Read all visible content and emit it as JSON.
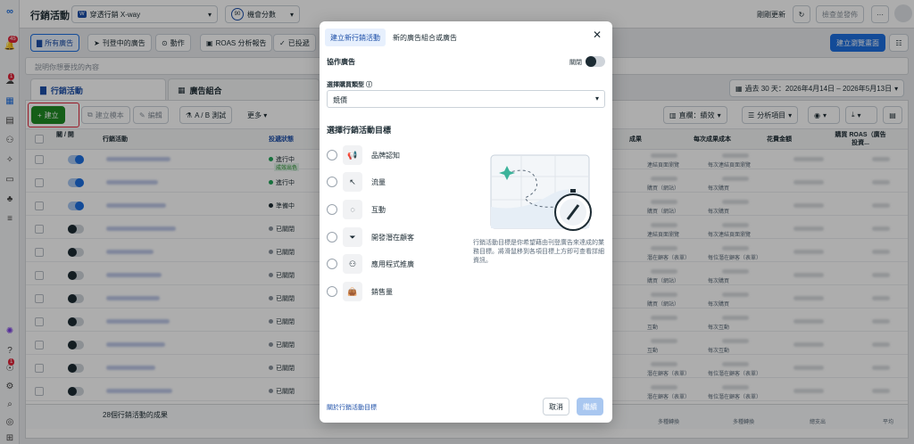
{
  "topbar": {
    "title": "行銷活動",
    "account": "穿透行銷 X-way",
    "score": "90",
    "score_label": "機會分數",
    "update": "剛剛更新",
    "review": "檢查並發佈",
    "more": "···"
  },
  "tabs": [
    "所有廣告",
    "刊登中的廣告",
    "動作",
    "ROAS 分析報告",
    "已投遞"
  ],
  "create_view": "建立瀏覽畫面",
  "search_placeholder": "說明你想要找的內容",
  "main_tabs": [
    "行銷活動",
    "廣告組合"
  ],
  "date_range": "過去 30 天：2026年4月14日 – 2026年5月13日",
  "toolbar": {
    "create": "建立",
    "template": "建立模本",
    "edit": "編輯",
    "ab": "A / B 測試",
    "more": "更多",
    "columns": "直欄：績效",
    "breakdown": "分析項目"
  },
  "table": {
    "headers": [
      "關 / 開",
      "行銷活動",
      "投遞狀態",
      "成果",
      "每次成果成本",
      "花費金額",
      "購買 ROAS（廣告投資..."
    ],
    "rows": [
      {
        "status": "進行中",
        "sub": "成效出色",
        "on": true,
        "color": "#22a55a",
        "result": "連結頁面瀏覽",
        "cost": "每次連結頁面瀏覽"
      },
      {
        "status": "進行中",
        "sub": "",
        "on": true,
        "color": "#22a55a",
        "result": "購買（網站）",
        "cost": "每次購買"
      },
      {
        "status": "準備中",
        "sub": "",
        "on": true,
        "color": "#1c2b33",
        "result": "購買（網站）",
        "cost": "每次購買"
      },
      {
        "status": "已關閉",
        "sub": "",
        "on": false,
        "color": "#8a939c",
        "result": "連結頁面瀏覽",
        "cost": "每次連結頁面瀏覽"
      },
      {
        "status": "已關閉",
        "sub": "",
        "on": false,
        "color": "#8a939c",
        "result": "潛在顧客（表單）",
        "cost": "每位潛在顧客（表單）"
      },
      {
        "status": "已關閉",
        "sub": "",
        "on": false,
        "color": "#8a939c",
        "result": "購買（網站）",
        "cost": "每次購買"
      },
      {
        "status": "已關閉",
        "sub": "",
        "on": false,
        "color": "#8a939c",
        "result": "購買（網站）",
        "cost": "每次購買"
      },
      {
        "status": "已關閉",
        "sub": "",
        "on": false,
        "color": "#8a939c",
        "result": "互動",
        "cost": "每次互動"
      },
      {
        "status": "已關閉",
        "sub": "",
        "on": false,
        "color": "#8a939c",
        "result": "互動",
        "cost": "每次互動"
      },
      {
        "status": "已關閉",
        "sub": "",
        "on": false,
        "color": "#8a939c",
        "result": "潛在顧客（表單）",
        "cost": "每位潛在顧客（表單）"
      },
      {
        "status": "已關閉",
        "sub": "",
        "on": false,
        "color": "#8a939c",
        "result": "潛在顧客（表單）",
        "cost": "每位潛在顧客（表單）"
      }
    ],
    "footer": "28個行銷活動的成果",
    "footer_cols": [
      "多種轉換",
      "多種轉換",
      "總支出",
      "平均"
    ]
  },
  "modal": {
    "tab_new": "建立新行銷活動",
    "tab_existing": "新的廣告組合或廣告",
    "collab_label": "協作廣告",
    "collab_state": "關閉",
    "buy_type_label": "選擇購買類型",
    "buy_type_value": "競價",
    "objective_title": "選擇行銷活動目標",
    "objectives": [
      "品牌認知",
      "流量",
      "互動",
      "開發潛在顧客",
      "應用程式推廣",
      "銷售量"
    ],
    "description": "行銷活動目標是你希望藉由刊登廣告來達成的業務目標。將滑鼠移到各項目標上方即可查看詳細資訊。",
    "about_link": "關於行銷活動目標",
    "cancel": "取消",
    "continue": "繼續"
  },
  "rail_badges": [
    "45",
    "1",
    "1"
  ],
  "colors": {
    "brand_blue": "#1d6fe0",
    "create_green": "#1f8b24",
    "highlight_red": "#e0263a",
    "map_teal": "#3bb39a"
  }
}
